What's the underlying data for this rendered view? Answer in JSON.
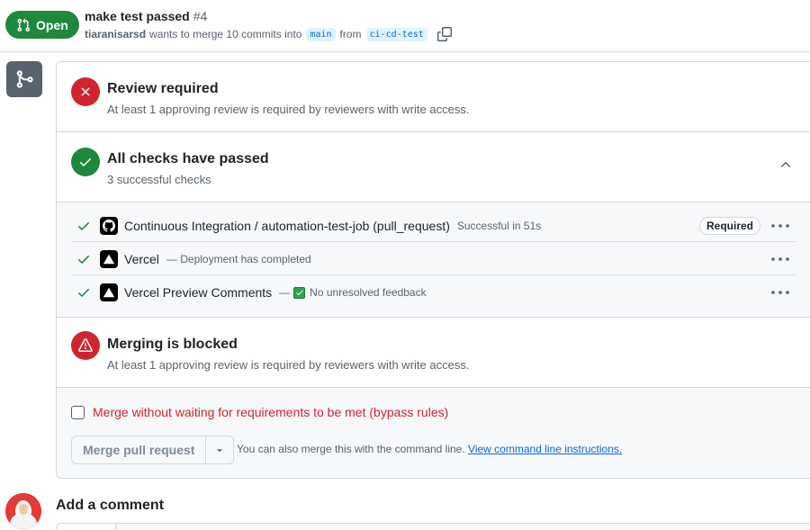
{
  "header": {
    "state_label": "Open",
    "title": "make test passed",
    "number": "#4",
    "author": "tiaranisarsd",
    "merge_text": "wants to merge 10 commits into",
    "base_branch": "main",
    "from_text": "from",
    "head_branch": "ci-cd-test"
  },
  "review": {
    "title": "Review required",
    "subtitle": "At least 1 approving review is required by reviewers with write access."
  },
  "checks": {
    "title": "All checks have passed",
    "subtitle": "3 successful checks",
    "items": [
      {
        "name": "Continuous Integration / automation-test-job (pull_request)",
        "desc": "Successful in 51s",
        "badge": "Required",
        "logo": "github-icon"
      },
      {
        "name": "Vercel",
        "desc": "— Deployment has completed",
        "logo": "vercel-icon"
      },
      {
        "name": "Vercel Preview Comments",
        "desc_prefix": "—",
        "desc": "No unresolved feedback",
        "logo": "vercel-icon"
      }
    ]
  },
  "blocked": {
    "title": "Merging is blocked",
    "subtitle": "At least 1 approving review is required by reviewers with write access."
  },
  "merge": {
    "bypass_label": "Merge without waiting for requirements to be met (bypass rules)",
    "button_label": "Merge pull request",
    "hint_text": "You can also merge this with the command line.",
    "hint_link": "View command line instructions."
  },
  "comment": {
    "heading": "Add a comment"
  },
  "colors": {
    "open_green": "#1f883d",
    "danger_red": "#d1242f",
    "link_blue": "#0969da"
  }
}
